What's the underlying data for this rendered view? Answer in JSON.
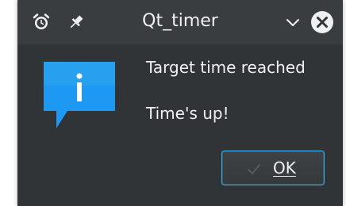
{
  "window": {
    "title": "Qt_timer"
  },
  "titlebar": {
    "app_icon": "alarm-clock-icon",
    "pin_icon": "pin-icon",
    "menu_icon": "chevron-down-icon",
    "close_icon": "close-icon"
  },
  "dialog": {
    "icon": "information-icon",
    "message": "Target time reached",
    "informative_text": "Time's up!",
    "ok_label": "OK",
    "ok_icon": "check-icon"
  },
  "colors": {
    "window_bg": "#313437",
    "titlebar_bg": "#3a3d40",
    "text": "#eff0f1",
    "accent": "#3daee9",
    "info_icon_blue": "#1d99f3"
  }
}
